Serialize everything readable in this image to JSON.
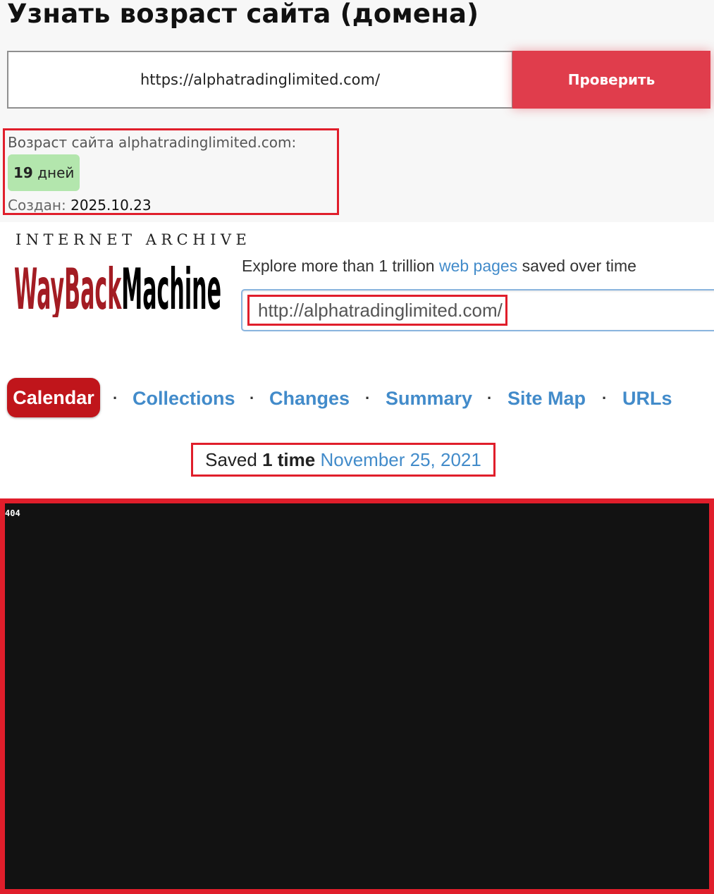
{
  "age_checker": {
    "title": "Узнать возраст сайта (домена)",
    "url_value": "https://alphatradinglimited.com/",
    "check_button_label": "Проверить",
    "age_label": "Возраст сайта alphatradinglimited.com:",
    "age_value": "19",
    "age_unit": "дней",
    "created_label": "Создан:",
    "created_value": "2025.10.23"
  },
  "wayback": {
    "header_label": "INTERNET ARCHIVE",
    "logo_text": "WayBackMachine",
    "explore_prefix": "Explore more than 1 trillion",
    "explore_link": "web pages",
    "explore_suffix": "saved over time",
    "search_value": "http://alphatradinglimited.com/",
    "tabs": {
      "calendar": "Calendar",
      "collections": "Collections",
      "changes": "Changes",
      "summary": "Summary",
      "site_map": "Site Map",
      "urls": "URLs",
      "separator": "·"
    },
    "saved_prefix": "Saved",
    "saved_count": "1 time",
    "saved_date": "November 25, 2021",
    "snapshot_text": "404"
  },
  "colors": {
    "accent_red": "#e03d4c",
    "highlight_red": "#e01e2b",
    "age_badge_green": "#b3e6ad",
    "wayback_link_blue": "#428bca",
    "calendar_tab_red": "#c0151b",
    "snapshot_background": "#121212"
  }
}
